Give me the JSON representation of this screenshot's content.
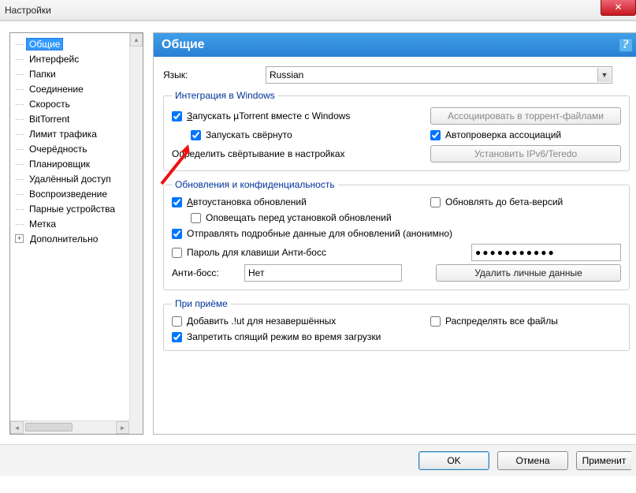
{
  "window": {
    "title": "Настройки"
  },
  "tree": {
    "items": [
      "Общие",
      "Интерфейс",
      "Папки",
      "Соединение",
      "Скорость",
      "BitTorrent",
      "Лимит трафика",
      "Очерёдность",
      "Планировщик",
      "Удалённый доступ",
      "Воспроизведение",
      "Парные устройства",
      "Метка",
      "Дополнительно"
    ],
    "selected_index": 0,
    "expandable_index": 13
  },
  "header": {
    "title": "Общие",
    "help": "?"
  },
  "language": {
    "label": "Язык:",
    "value": "Russian"
  },
  "groups": {
    "integration": {
      "legend": "Интеграция в Windows",
      "start_with_windows_pre": "З",
      "start_with_windows": "апускать µTorrent вместе с Windows",
      "start_minimized": "Запускать свёрнуто",
      "minimize_in_settings": "Определить свёртывание в настройках",
      "assoc_torrent_btn": "Ассоциировать в торрент-файлами",
      "auto_check_assoc": "Автопроверка ассоциаций",
      "install_ipv6_btn": "Установить IPv6/Teredo"
    },
    "updates": {
      "legend": "Обновления и конфиденциальность",
      "auto_update_pre": "А",
      "auto_update": "втоустановка обновлений",
      "update_beta": "Обновлять до бета-версий",
      "notify_before": "Оповещать перед установкой обновлений",
      "send_stats": "Отправлять подробные данные для обновлений (анонимно)",
      "boss_pw_label": "Пароль для клавиши Анти-босс",
      "boss_pw_value": "●●●●●●●●●●●",
      "antiboss_label": "Анти-босс:",
      "antiboss_value": "Нет",
      "delete_data_btn": "Удалить личные данные"
    },
    "receive": {
      "legend": "При приёме",
      "add_ut": "Добавить .!ut для незавершённых",
      "distribute": "Распределять все файлы",
      "no_sleep": "Запретить спящий режим во время загрузки"
    }
  },
  "buttons": {
    "ok": "OK",
    "cancel": "Отмена",
    "apply": "Применит"
  },
  "checked": {
    "start_with_windows": true,
    "start_minimized": true,
    "auto_check_assoc": true,
    "auto_update": true,
    "update_beta": false,
    "notify_before": false,
    "send_stats": true,
    "boss_pw": false,
    "add_ut": false,
    "distribute": false,
    "no_sleep": true
  }
}
